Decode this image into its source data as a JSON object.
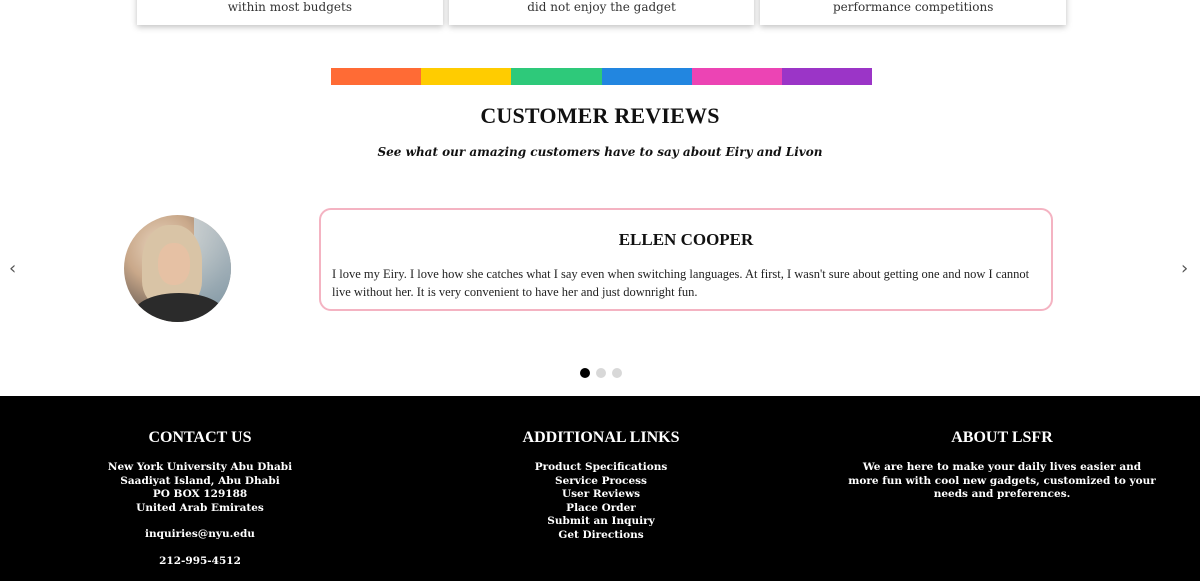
{
  "top_cards": [
    {
      "caption": "within most budgets"
    },
    {
      "caption": "did not enjoy the gadget"
    },
    {
      "caption": "performance competitions"
    }
  ],
  "rainbow_colors": [
    "#ff6b35",
    "#ffcc00",
    "#2ec97a",
    "#2286e0",
    "#ec44b4",
    "#9b35c7"
  ],
  "reviews": {
    "title": "CUSTOMER REVIEWS",
    "subtitle": "See what our amazing customers have to say about Eiry and Livon",
    "current": {
      "name": "ELLEN COOPER",
      "text": "I love my Eiry. I love how she catches what I say even when switching languages. At first, I wasn't sure about getting one and now I cannot live without her. It is very convenient to have her and just downright fun."
    },
    "prev_icon": "chevron-left-icon",
    "next_icon": "chevron-right-icon",
    "active_dot": 0,
    "dot_count": 3
  },
  "footer": {
    "contact": {
      "title": "CONTACT US",
      "address": [
        "New York University Abu Dhabi",
        "Saadiyat Island, Abu Dhabi",
        "PO BOX 129188",
        "United Arab Emirates"
      ],
      "email": "inquiries@nyu.edu",
      "phone": "212-995-4512"
    },
    "links": {
      "title": "ADDITIONAL LINKS",
      "items": [
        "Product Specifications",
        "Service Process",
        "User Reviews",
        "Place Order",
        "Submit an Inquiry",
        "Get Directions"
      ]
    },
    "about": {
      "title": "ABOUT LSFR",
      "text": "We are here to make your daily lives easier and more fun with cool new gadgets, customized to your needs and preferences."
    }
  }
}
